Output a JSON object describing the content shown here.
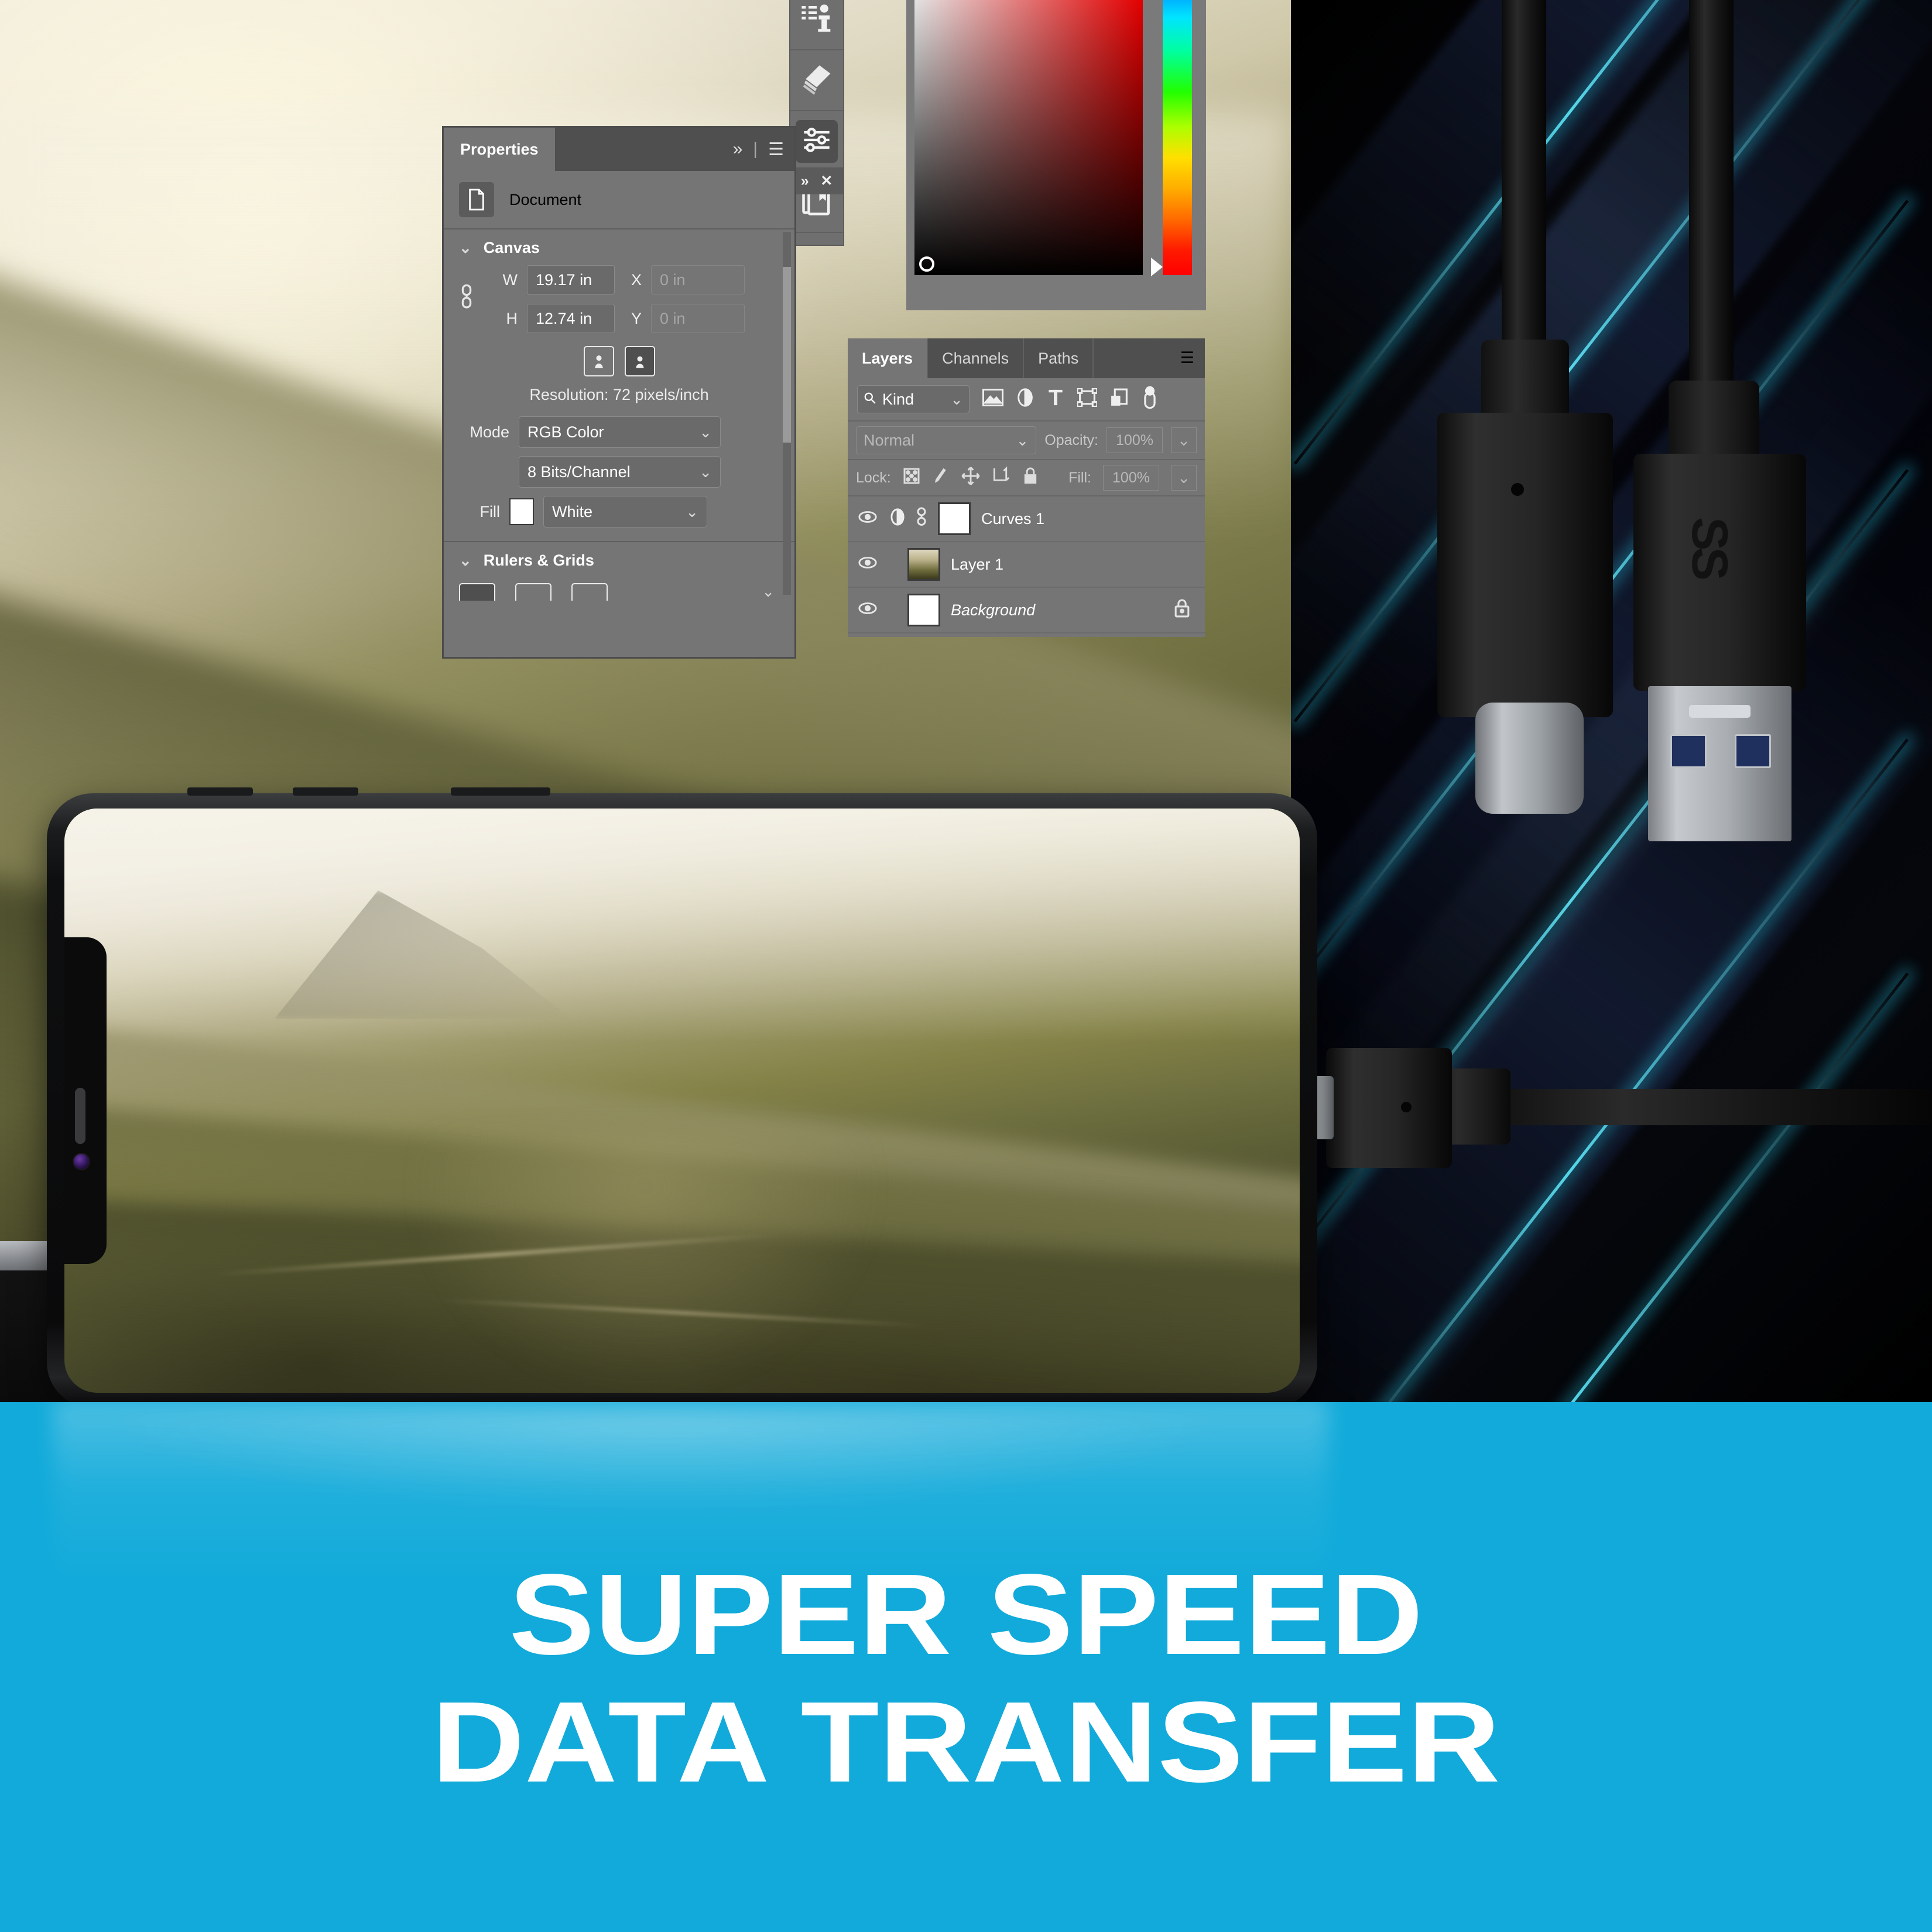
{
  "photoshop": {
    "properties_panel": {
      "tab_label": "Properties",
      "collapse_icon": "chevrons-right-icon",
      "menu_icon": "hamburger-menu-icon",
      "document_row": {
        "icon": "document-icon",
        "label": "Document"
      },
      "canvas_section": {
        "title": "Canvas",
        "chevron": "chevron-down-icon",
        "link_icon": "link-chain-icon",
        "width_label": "W",
        "width_value": "19.17 in",
        "height_label": "H",
        "height_value": "12.74 in",
        "x_label": "X",
        "x_value": "0 in",
        "y_label": "Y",
        "y_value": "0 in",
        "orientation_portrait_icon": "portrait-orientation-icon",
        "orientation_landscape_icon": "landscape-orientation-icon",
        "resolution": "Resolution: 72 pixels/inch",
        "mode_label": "Mode",
        "mode_value": "RGB Color",
        "depth_value": "8 Bits/Channel",
        "fill_label": "Fill",
        "fill_value": "White",
        "fill_swatch_color": "#ffffff"
      },
      "rulers_section": {
        "title": "Rulers & Grids",
        "chevron": "chevron-down-icon",
        "ruler_icons": [
          "ruler-icon-1",
          "ruler-icon-2",
          "ruler-icon-3"
        ],
        "more_chevron": "chevron-down-icon"
      }
    },
    "layers_panel": {
      "tabs": [
        {
          "label": "Layers",
          "active": true
        },
        {
          "label": "Channels",
          "active": false
        },
        {
          "label": "Paths",
          "active": false
        }
      ],
      "menu_icon": "hamburger-menu-icon",
      "filter": {
        "search_icon": "search-icon",
        "kind_label": "Kind",
        "chevron": "chevron-down-icon",
        "type_icons": [
          "image-filter-icon",
          "adjustment-filter-icon",
          "text-filter-icon",
          "shape-filter-icon",
          "smart-object-filter-icon"
        ],
        "toggle_icon": "filter-toggle-switch"
      },
      "blend_mode": "Normal",
      "blend_chevron": "chevron-down-icon",
      "opacity_label": "Opacity:",
      "opacity_value": "100%",
      "lock_label": "Lock:",
      "lock_icons": [
        "lock-transparency-icon",
        "lock-image-icon",
        "lock-position-icon",
        "lock-artboard-icon",
        "lock-all-icon"
      ],
      "fill_label": "Fill:",
      "fill_value": "100%",
      "layers": [
        {
          "visible_icon": "eye-icon",
          "type_icon": "adjustment-half-circle-icon",
          "link_icon": "link-chain-icon",
          "thumb": "white",
          "name": "Curves 1",
          "locked": false
        },
        {
          "visible_icon": "eye-icon",
          "type_icon": "",
          "link_icon": "",
          "thumb": "photo",
          "name": "Layer 1",
          "locked": false
        },
        {
          "visible_icon": "eye-icon",
          "type_icon": "",
          "link_icon": "",
          "thumb": "white",
          "name": "Background",
          "locked": true,
          "lock_icon": "lock-icon"
        }
      ]
    },
    "tool_column": {
      "buttons": [
        {
          "icon": "clone-stamp-panel-icon",
          "selected": false
        },
        {
          "icon": "history-brush-panel-icon",
          "selected": false
        },
        {
          "icon": "adjustments-sliders-icon",
          "selected": true
        },
        {
          "icon": "libraries-book-icon",
          "selected": false
        }
      ],
      "mini_bar": {
        "expand_icon": "chevrons-right-icon",
        "close_icon": "close-x-icon"
      }
    },
    "color_picker": {
      "field_icon": "saturation-brightness-field",
      "hue_strip_icon": "hue-slider",
      "field_marker_icon": "color-marker-circle",
      "hue_marker_icon": "hue-slider-arrow"
    }
  },
  "hardware": {
    "usb_c_connector_left": {
      "name": "usb-c-connector",
      "dot_icon": "alignment-dot"
    },
    "usb_a_connector_right": {
      "name": "usb-a-connector",
      "logo_text": "SS",
      "logo_icon": "usb-superspeed-trident-icon"
    },
    "usb_c_plugged": {
      "name": "usb-c-connector-plugged",
      "dot_icon": "alignment-dot"
    },
    "phone": {
      "name": "smartphone",
      "notch_icons": [
        "earpiece-speaker",
        "front-camera"
      ],
      "buttons": [
        "volume-up-button",
        "volume-down-button",
        "power-button",
        "bottom-port"
      ]
    }
  },
  "footer": {
    "headline_line1": "SUPER SPEED",
    "headline_line2": "DATA TRANSFER",
    "background_color": "#11aada",
    "text_color": "#ffffff"
  },
  "colors": {
    "cyan_accent": "#11aada",
    "glow_cyan": "#5ae1f5",
    "panel_gray": "#757575",
    "panel_dark_gray": "#4f4f4f"
  }
}
